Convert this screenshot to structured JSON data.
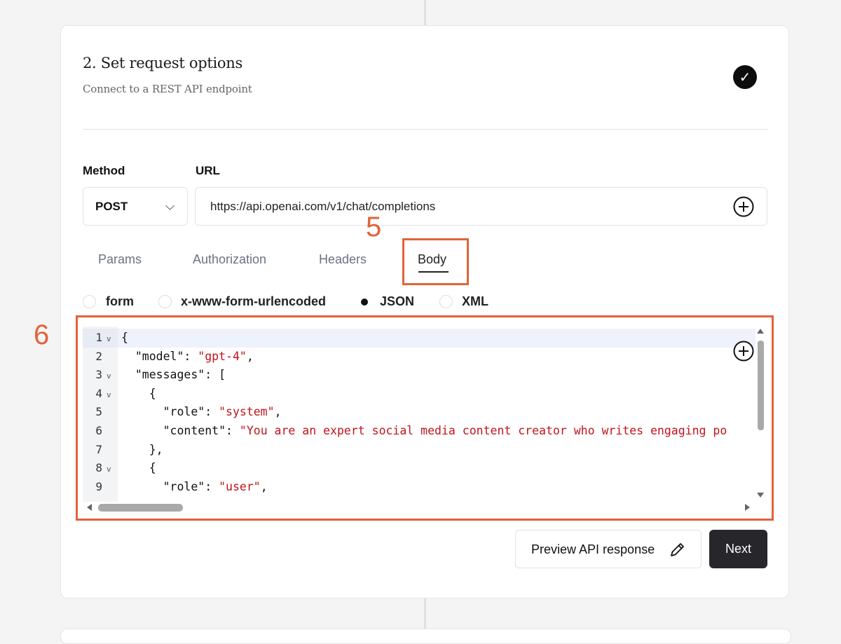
{
  "step": {
    "title": "2. Set request options",
    "subtitle": "Connect to a REST API endpoint",
    "status_icon": "check-circle-icon"
  },
  "request": {
    "method_label": "Method",
    "method_value": "POST",
    "url_label": "URL",
    "url_value": "https://api.openai.com/v1/chat/completions"
  },
  "tabs": [
    {
      "label": "Params",
      "active": false
    },
    {
      "label": "Authorization",
      "active": false
    },
    {
      "label": "Headers",
      "active": false
    },
    {
      "label": "Body",
      "active": true
    }
  ],
  "body_types": [
    {
      "label": "form",
      "selected": false
    },
    {
      "label": "x-www-form-urlencoded",
      "selected": false
    },
    {
      "label": "JSON",
      "selected": true
    },
    {
      "label": "XML",
      "selected": false
    }
  ],
  "annotations": {
    "tab_marker": "5",
    "editor_marker": "6",
    "highlight_color": "#e3623a"
  },
  "editor": {
    "line_numbers": [
      "1",
      "2",
      "3",
      "4",
      "5",
      "6",
      "7",
      "8",
      "9"
    ],
    "folds": [
      "v",
      "",
      "v",
      "v",
      "",
      "",
      "",
      "v",
      ""
    ],
    "lines": [
      "{",
      "  \"model\": \"gpt-4\",",
      "  \"messages\": [",
      "    {",
      "      \"role\": \"system\",",
      "      \"content\": \"You are an expert social media content creator who writes engaging po",
      "    },",
      "    {",
      "      \"role\": \"user\","
    ]
  },
  "actions": {
    "preview_label": "Preview API response",
    "next_label": "Next"
  },
  "colors": {
    "accent_dark": "#26262b",
    "string": "#c0141a"
  }
}
